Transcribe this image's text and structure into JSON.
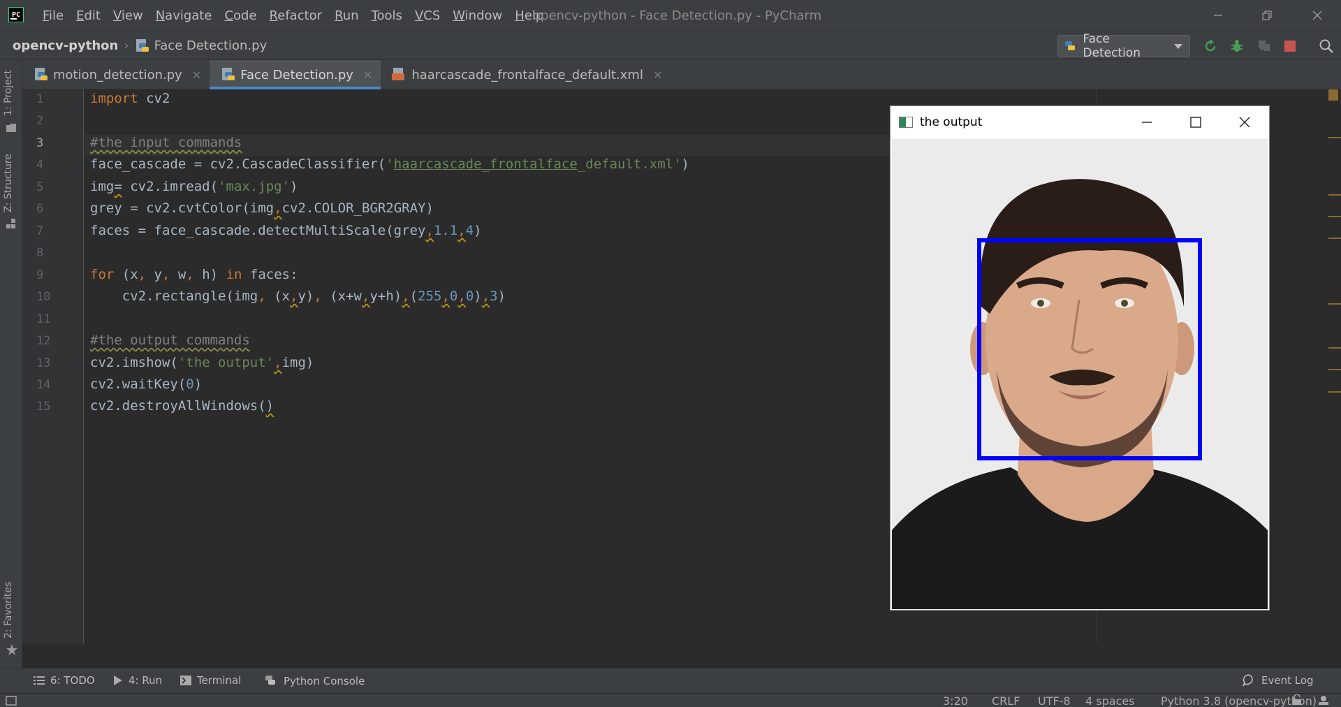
{
  "titlebar": {
    "logo_text": "PC",
    "menus": [
      {
        "label": "File",
        "key": "F",
        "rest": "ile"
      },
      {
        "label": "Edit",
        "key": "E",
        "rest": "dit"
      },
      {
        "label": "View",
        "key": "V",
        "rest": "iew"
      },
      {
        "label": "Navigate",
        "key": "N",
        "rest": "avigate"
      },
      {
        "label": "Code",
        "key": "C",
        "rest": "ode"
      },
      {
        "label": "Refactor",
        "key": "R",
        "rest": "efactor"
      },
      {
        "label": "Run",
        "key": "R",
        "rest": "un"
      },
      {
        "label": "Tools",
        "key": "T",
        "rest": "ools"
      },
      {
        "label": "VCS",
        "key": "V",
        "rest": "CS"
      },
      {
        "label": "Window",
        "key": "W",
        "rest": "indow"
      },
      {
        "label": "Help",
        "key": "H",
        "rest": "elp"
      }
    ],
    "window_title": "opencv-python - Face Detection.py - PyCharm"
  },
  "navbar": {
    "project": "opencv-python",
    "file": "Face Detection.py",
    "run_config": "Face Detection"
  },
  "left_stripe": {
    "project_tab": "1: Project",
    "structure_tab": "Z: Structure",
    "favorites_tab": "2: Favorites"
  },
  "tabs": [
    {
      "label": "motion_detection.py",
      "active": false
    },
    {
      "label": "Face Detection.py",
      "active": true
    },
    {
      "label": "haarcascade_frontalface_default.xml",
      "active": false
    }
  ],
  "editor": {
    "current_line": 3,
    "line_numbers": [
      "1",
      "2",
      "3",
      "4",
      "5",
      "6",
      "7",
      "8",
      "9",
      "10",
      "11",
      "12",
      "13",
      "14",
      "15"
    ]
  },
  "output_window": {
    "title": "the output"
  },
  "bottom_tools": [
    {
      "label": "6: TODO",
      "icon": "list-icon"
    },
    {
      "label": "4: Run",
      "icon": "run-icon"
    },
    {
      "label": "Terminal",
      "icon": "terminal-icon"
    },
    {
      "label": "Python Console",
      "icon": "python-console-icon"
    },
    {
      "label": "Event Log",
      "icon": "event-log-icon"
    }
  ],
  "status_bar": {
    "position": "3:20",
    "line_sep": "CRLF",
    "encoding": "UTF-8",
    "indent": "4 spaces",
    "interpreter": "Python 3.8 (opencv-python)"
  },
  "colors": {
    "keyword": "#cc7832",
    "string": "#6a8759",
    "number": "#6897bb",
    "comment": "#808080",
    "tab_underline": "#4a88c7",
    "detection_box": "#0000ff"
  }
}
